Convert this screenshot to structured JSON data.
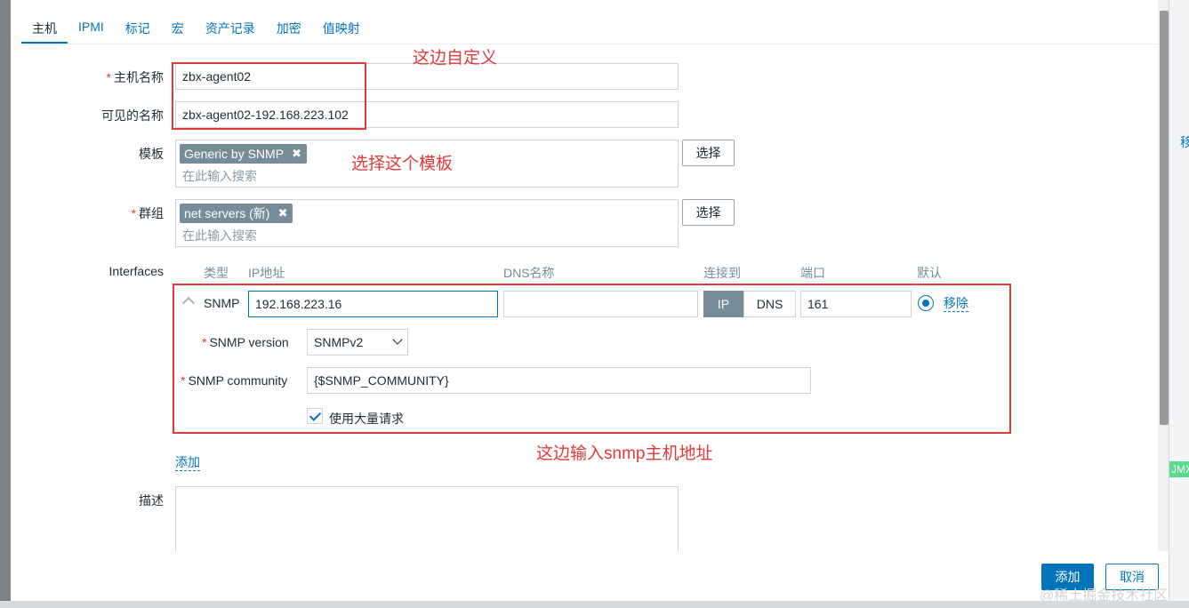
{
  "tabs": [
    "主机",
    "IPMI",
    "标记",
    "宏",
    "资产记录",
    "加密",
    "值映射"
  ],
  "form": {
    "host_name_label": "主机名称",
    "host_name_value": "zbx-agent02",
    "visible_name_label": "可见的名称",
    "visible_name_value": "zbx-agent02-192.168.223.102",
    "templates_label": "模板",
    "templates_chip": "Generic by SNMP",
    "templates_placeholder": "在此输入搜索",
    "select_label": "选择",
    "groups_label": "群组",
    "groups_chip": "net servers (新)",
    "groups_placeholder": "在此输入搜索",
    "interfaces_label": "Interfaces",
    "description_label": "描述",
    "add_link": "添加",
    "required_mark": "*",
    "chip_remove": "✖"
  },
  "interfaces": {
    "headers": {
      "type": "类型",
      "ip": "IP地址",
      "dns": "DNS名称",
      "connect_to": "连接到",
      "port": "端口",
      "default": "默认"
    },
    "row": {
      "type": "SNMP",
      "ip": "192.168.223.16",
      "dns": "",
      "connect_ip": "IP",
      "connect_dns": "DNS",
      "port": "161",
      "remove": "移除"
    },
    "snmp_version_label": "SNMP version",
    "snmp_version_value": "SNMPv2",
    "snmp_community_label": "SNMP community",
    "snmp_community_value": "{$SNMP_COMMUNITY}",
    "bulk_label": "使用大量请求",
    "bulk_checked": true
  },
  "footer": {
    "add_button": "添加",
    "cancel_button": "取消",
    "watermark": "@稀土掘金技术社区"
  },
  "annotations": {
    "custom_here": "这边自定义",
    "choose_template": "选择这个模板",
    "enter_snmp": "这边输入snmp主机地址"
  },
  "background": {
    "peek_text": "移",
    "peek_badge": "JMX"
  },
  "colors": {
    "accent": "#0275b8",
    "annotation_red": "#e03a3a",
    "chip": "#768d99",
    "required": "#e33734"
  }
}
